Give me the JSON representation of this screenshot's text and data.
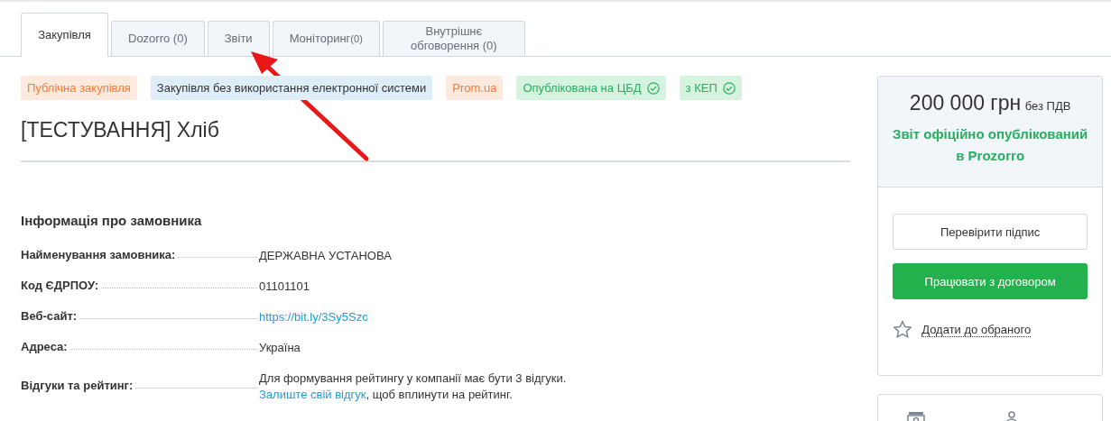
{
  "tabs": [
    {
      "label": "Закупівля",
      "selected": true
    },
    {
      "label": "Dozorro (0)",
      "selected": false
    },
    {
      "label": "Звіти",
      "selected": false
    },
    {
      "label": "Моніторинг",
      "count": "(0)",
      "selected": false
    },
    {
      "label": "Внутрішнє обговорення (0)",
      "selected": false
    }
  ],
  "tags": [
    {
      "label": "Публічна закупівля",
      "kind": "accent",
      "verified": false
    },
    {
      "label": "Закупівля без використання електронної системи",
      "kind": "info",
      "verified": false
    },
    {
      "label": "Prom.ua",
      "kind": "accent",
      "verified": false
    },
    {
      "label": "Опублікована на ЦБД",
      "kind": "success",
      "verified": true
    },
    {
      "label": "з КЕП",
      "kind": "success",
      "verified": true
    }
  ],
  "title": "[ТЕСТУВАННЯ] Хліб",
  "section_heading": "Інформація про замовника",
  "fields": [
    {
      "label": "Найменування замовника:",
      "value": "ДЕРЖАВНА УСТАНОВА",
      "kind": "text"
    },
    {
      "label": "Код ЄДРПОУ:",
      "value": "01101101",
      "kind": "text"
    },
    {
      "label": "Веб-сайт:",
      "value": "https://bit.ly/3Sy5Szc",
      "kind": "link"
    },
    {
      "label": "Адреса:",
      "value": "Україна",
      "kind": "text"
    },
    {
      "label": "Відгуки та рейтинг:",
      "value": "Для формування рейтингу у компанії має бути 3 відгуки.",
      "link": "Залиште свій відгук",
      "after": ", щоб вплинути на рейтинг.",
      "kind": "review"
    }
  ],
  "summary": {
    "amount": "200 000 грн",
    "vat_note": "без ПДВ",
    "status": "Звіт офіційно опублікований в Prozorro",
    "buttons": [
      {
        "label": "Перевірити підпис",
        "kind": "outline"
      },
      {
        "label": "Працювати з договором",
        "kind": "primary"
      }
    ],
    "favorite": "Додати до обраного"
  }
}
